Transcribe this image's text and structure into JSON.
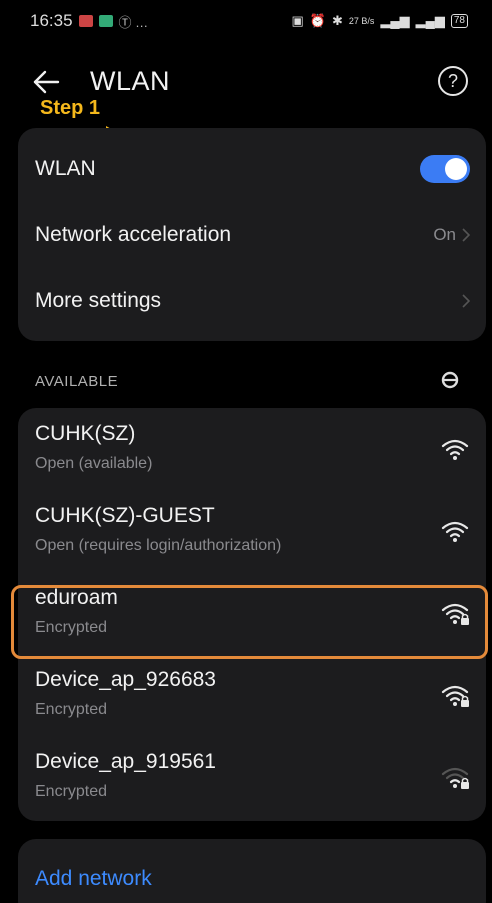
{
  "status_bar": {
    "time": "16:35",
    "left_icons": "Ⓣ …",
    "right_text": "27 B/s",
    "battery": "78"
  },
  "header": {
    "title": "WLAN",
    "back_icon": "back-arrow-icon",
    "help_icon": "help-icon",
    "help_glyph": "?"
  },
  "annotation": {
    "step_label": "Step 1",
    "arrow_color": "#f5b81c",
    "highlight_color": "#e48a3a"
  },
  "settings": {
    "wlan_label": "WLAN",
    "wlan_enabled": true,
    "network_acceleration_label": "Network acceleration",
    "network_acceleration_value": "On",
    "more_settings_label": "More settings"
  },
  "available": {
    "header": "AVAILABLE",
    "networks": [
      {
        "name": "CUHK(SZ)",
        "status": "Open (available)",
        "locked": false,
        "strength": 1.0
      },
      {
        "name": "CUHK(SZ)-GUEST",
        "status": "Open (requires login/authorization)",
        "locked": false,
        "strength": 1.0
      },
      {
        "name": "eduroam",
        "status": "Encrypted",
        "locked": true,
        "strength": 1.0
      },
      {
        "name": "Device_ap_926683",
        "status": "Encrypted",
        "locked": true,
        "strength": 1.0
      },
      {
        "name": "Device_ap_919561",
        "status": "Encrypted",
        "locked": true,
        "strength": 0.33
      }
    ]
  },
  "add_network_label": "Add network",
  "colors": {
    "background": "#000000",
    "card": "#1c1c1e",
    "accent": "#3b7cf4",
    "link": "#3d8bff",
    "secondary_text": "#8a8a8e"
  }
}
